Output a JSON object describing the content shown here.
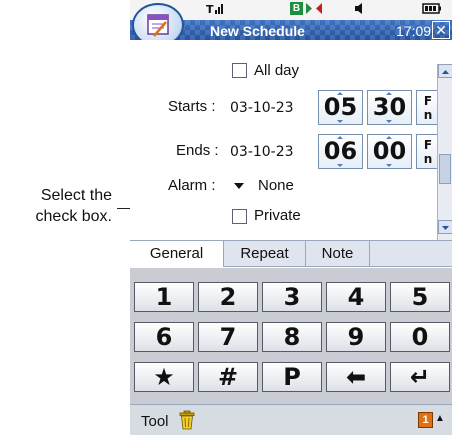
{
  "callout": {
    "line1": "Select the",
    "line2": "check box."
  },
  "status": {
    "signal_icon": "signal-icon",
    "message_badge": "B",
    "sync_icon": "sync-icon",
    "volume_icon": "speaker-icon",
    "battery_icon": "battery-icon"
  },
  "titlebar": {
    "title": "New Schedule",
    "time": "17:09",
    "close_glyph": "✕",
    "app_icon": "calendar-icon"
  },
  "form": {
    "all_day_label": "All day",
    "starts_label": "Starts :",
    "starts_date": "03-10-23",
    "starts_hour": "05",
    "starts_minute": "30",
    "ends_label": "Ends :",
    "ends_date": "03-10-23",
    "ends_hour": "06",
    "ends_minute": "00",
    "alarm_label": "Alarm :",
    "alarm_value": "None",
    "private_label": "Private",
    "cut_text": "F\nn"
  },
  "tabs": [
    {
      "label": "General"
    },
    {
      "label": "Repeat"
    },
    {
      "label": "Note"
    }
  ],
  "keypad": {
    "rows": [
      [
        "1",
        "2",
        "3",
        "4",
        "5"
      ],
      [
        "6",
        "7",
        "8",
        "9",
        "0"
      ],
      [
        "★",
        "#",
        "P",
        "⬅",
        "↵"
      ]
    ]
  },
  "bottombar": {
    "tool_label": "Tool",
    "trash_icon": "trash-icon",
    "badge": "1",
    "menu_glyph": "▲"
  },
  "colors": {
    "title_blue": "#24539f",
    "accent_orange": "#e07010"
  }
}
